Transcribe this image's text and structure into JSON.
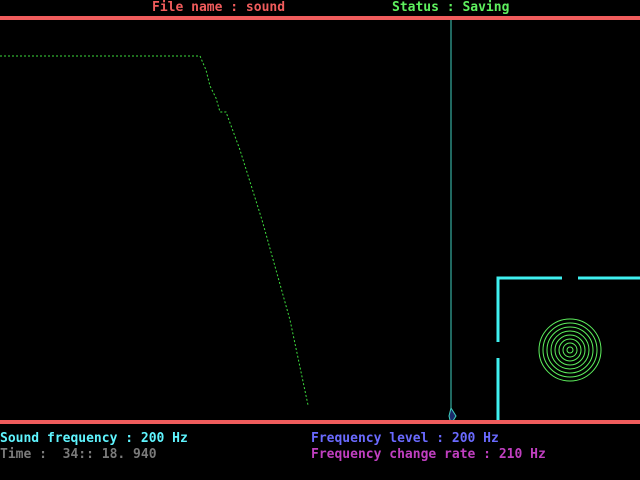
{
  "header": {
    "file_name_label": "File name : sound",
    "status_label": "Status : Saving"
  },
  "footer": {
    "sound_frequency": "Sound frequency : 200 Hz",
    "time": "Time :  34:: 18. 940",
    "frequency_level": "Frequency level : 200 Hz",
    "frequency_change_rate": "Frequency change rate : 210 Hz"
  },
  "colors": {
    "bar": "#f05c5c",
    "trace": "#3ddc3d",
    "cursor": "#3fd0c0",
    "box": "#3ff0f0",
    "rings": "#5ef05e",
    "cyan_text": "#5ff5ff",
    "blue_text": "#6a6aff",
    "grey_text": "#7a7a7a",
    "magenta_text": "#c03fc0",
    "green_text": "#5ef05e"
  }
}
